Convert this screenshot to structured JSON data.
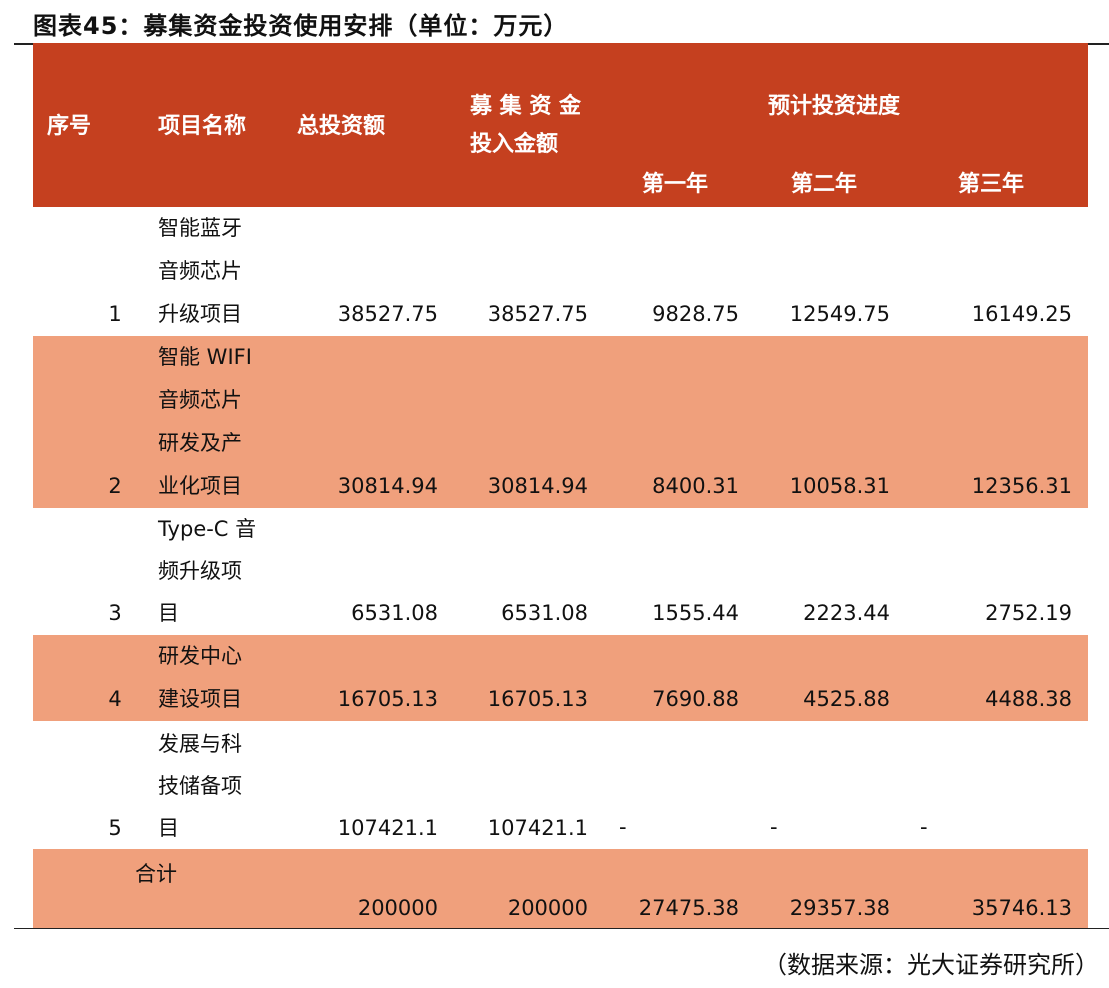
{
  "title": "图表45：募集资金投资使用安排（单位：万元）",
  "header": {
    "seq": "序号",
    "name": "项目名称",
    "total": "总投资额",
    "fund_line1": "募 集 资 金",
    "fund_line2": "投入金额",
    "progress": "预计投资进度",
    "y1": "第一年",
    "y2": "第二年",
    "y3": "第三年"
  },
  "rows": [
    {
      "seq": "1",
      "name": [
        "智能蓝牙",
        "音频芯片",
        "升级项目"
      ],
      "total": "38527.75",
      "fund": "38527.75",
      "y1": "9828.75",
      "y2": "12549.75",
      "y3": "16149.25"
    },
    {
      "seq": "2",
      "name": [
        "智能 WIFI",
        "音频芯片",
        "研发及产",
        "业化项目"
      ],
      "total": "30814.94",
      "fund": "30814.94",
      "y1": "8400.31",
      "y2": "10058.31",
      "y3": "12356.31"
    },
    {
      "seq": "3",
      "name": [
        "Type-C 音",
        "频升级项",
        "目"
      ],
      "total": "6531.08",
      "fund": "6531.08",
      "y1": "1555.44",
      "y2": "2223.44",
      "y3": "2752.19"
    },
    {
      "seq": "4",
      "name": [
        "研发中心",
        "建设项目"
      ],
      "total": "16705.13",
      "fund": "16705.13",
      "y1": "7690.88",
      "y2": "4525.88",
      "y3": "4488.38"
    },
    {
      "seq": "5",
      "name": [
        "发展与科",
        "技储备项",
        "目"
      ],
      "total": "107421.1",
      "fund": "107421.1",
      "y1": "-",
      "y2": "-",
      "y3": "-"
    }
  ],
  "total_row": {
    "label": "合计",
    "total": "200000",
    "fund": "200000",
    "y1": "27475.38",
    "y2": "29357.38",
    "y3": "35746.13"
  },
  "source": "（数据来源：光大证券研究所）"
}
